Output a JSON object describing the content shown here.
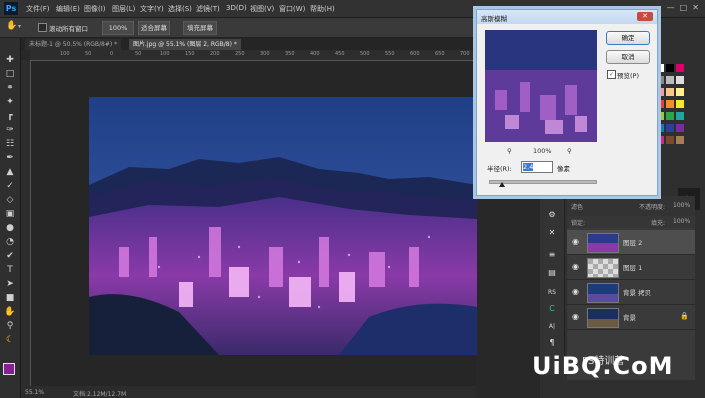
{
  "app": {
    "logo": "Ps"
  },
  "menu": [
    "文件(F)",
    "编辑(E)",
    "图像(I)",
    "图层(L)",
    "文字(Y)",
    "选择(S)",
    "滤镜(T)",
    "3D(D)",
    "视图(V)",
    "窗口(W)",
    "帮助(H)"
  ],
  "options_bar": {
    "scroll_all": "滚动所有窗口",
    "zoom": "100%",
    "fit_screen": "适合屏幕",
    "fill_screen": "填充屏幕"
  },
  "tabs": [
    {
      "label": "未标题-1 @ 50.5% (RGB/8#) *",
      "active": false
    },
    {
      "label": "图片.jpg @ 55.1% (图层 2, RGB/8) *",
      "active": true
    }
  ],
  "ruler_ticks": [
    "100",
    "50",
    "0",
    "50",
    "100",
    "150",
    "200",
    "250",
    "300",
    "350",
    "400",
    "450",
    "500",
    "550",
    "600",
    "650",
    "700"
  ],
  "status": {
    "zoom": "55.1%",
    "doc": "文档:2.12M/12.7M"
  },
  "dialog": {
    "title": "高斯模糊",
    "ok": "确定",
    "cancel": "取消",
    "preview_label": "预览(P)",
    "preview_checked": true,
    "zoom_level": "100%",
    "radius_label": "半径(R):",
    "radius_value": "2.4",
    "radius_unit": "像素"
  },
  "layers_panel": {
    "blend_mode": "滤色",
    "opacity_label": "不透明度:",
    "opacity_value": "100%",
    "fill_label": "填充:",
    "fill_value": "100%",
    "lock_label": "锁定:",
    "layers": [
      {
        "name": "图层 2",
        "selected": true,
        "locked": false
      },
      {
        "name": "图层 1",
        "selected": false,
        "locked": false
      },
      {
        "name": "背景 拷贝",
        "selected": false,
        "locked": false
      },
      {
        "name": "背景",
        "selected": false,
        "locked": true
      }
    ]
  },
  "strip_icons": [
    "RS",
    "C",
    "A|",
    "¶"
  ],
  "watermark": {
    "text": "UiBQ.CoM",
    "sub": "PS特训营"
  },
  "colors": {
    "menubar": "#323232",
    "panel": "#3a3a3a",
    "accent": "#31a8ff",
    "dialog_bg": "#f0f0f0"
  }
}
